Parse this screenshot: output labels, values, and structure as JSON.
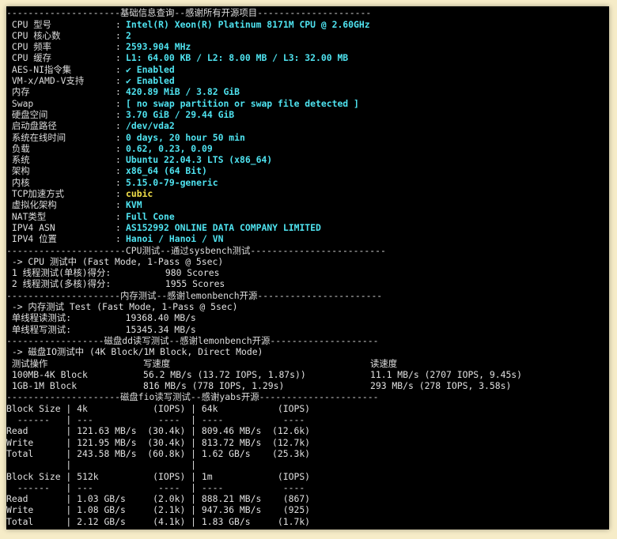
{
  "banners": {
    "basic": "---------------------基础信息查询--感谢所有开源项目---------------------",
    "cpu": "----------------------CPU测试--通过sysbench测试-------------------------",
    "mem": "---------------------内存测试--感谢lemonbench开源-----------------------",
    "disk_dd": "------------------磁盘dd读写测试--感谢lemonbench开源--------------------",
    "fio": "---------------------磁盘fio读写测试--感谢yabs开源----------------------"
  },
  "basic_info": [
    {
      "label": " CPU 型号",
      "value": "Intel(R) Xeon(R) Platinum 8171M CPU @ 2.60GHz",
      "color": "cyan"
    },
    {
      "label": " CPU 核心数",
      "value": "2",
      "color": "cyan"
    },
    {
      "label": " CPU 频率",
      "value": "2593.904 MHz",
      "color": "cyan"
    },
    {
      "label": " CPU 缓存",
      "value": "L1: 64.00 KB / L2: 8.00 MB / L3: 32.00 MB",
      "color": "cyan"
    },
    {
      "label": " AES-NI指令集",
      "value": "✔ Enabled",
      "color": "cyan"
    },
    {
      "label": " VM-x/AMD-V支持",
      "value": "✔ Enabled",
      "color": "cyan"
    },
    {
      "label": " 内存",
      "value": "420.89 MiB / 3.82 GiB",
      "color": "cyan"
    },
    {
      "label": " Swap",
      "value": "[ no swap partition or swap file detected ]",
      "color": "cyan"
    },
    {
      "label": " 硬盘空间",
      "value": "3.70 GiB / 29.44 GiB",
      "color": "cyan"
    },
    {
      "label": " 启动盘路径",
      "value": "/dev/vda2",
      "color": "cyan"
    },
    {
      "label": " 系统在线时间",
      "value": "0 days, 20 hour 50 min",
      "color": "cyan"
    },
    {
      "label": " 负载",
      "value": "0.62, 0.23, 0.09",
      "color": "cyan"
    },
    {
      "label": " 系统",
      "value": "Ubuntu 22.04.3 LTS (x86_64)",
      "color": "cyan"
    },
    {
      "label": " 架构",
      "value": "x86_64 (64 Bit)",
      "color": "cyan"
    },
    {
      "label": " 内核",
      "value": "5.15.0-79-generic",
      "color": "cyan"
    },
    {
      "label": " TCP加速方式",
      "value": "cubic",
      "color": "yellow"
    },
    {
      "label": " 虚拟化架构",
      "value": "KVM",
      "color": "cyan"
    },
    {
      "label": " NAT类型",
      "value": "Full Cone",
      "color": "cyan"
    },
    {
      "label": " IPV4 ASN",
      "value": "AS152992 ONLINE DATA COMPANY LIMITED",
      "color": "cyan"
    },
    {
      "label": " IPV4 位置",
      "value": "Hanoi / Hanoi / VN",
      "color": "cyan"
    }
  ],
  "cpu_test": {
    "header": " -> CPU 测试中 (Fast Mode, 1-Pass @ 5sec)",
    "single": " 1 线程测试(单核)得分:          980 Scores",
    "multi": " 2 线程测试(多核)得分:          1955 Scores"
  },
  "mem_test": {
    "header": " -> 内存测试 Test (Fast Mode, 1-Pass @ 5sec)",
    "read": " 单线程读测试:          19368.40 MB/s",
    "write": " 单线程写测试:          15345.34 MB/s"
  },
  "dd_test": {
    "header": " -> 磁盘IO测试中 (4K Block/1M Block, Direct Mode)",
    "columns": [
      " 测试操作",
      "写速度",
      "读速度"
    ],
    "rows": [
      [
        " 100MB-4K Block",
        "56.2 MB/s (13.72 IOPS, 1.87s))",
        "11.1 MB/s (2707 IOPS, 9.45s)"
      ],
      [
        " 1GB-1M Block",
        "816 MB/s (778 IOPS, 1.29s)",
        "293 MB/s (278 IOPS, 3.58s)"
      ]
    ]
  },
  "fio_lines": [
    "Block Size | 4k            (IOPS) | 64k           (IOPS)",
    "  ------   | ---            ----  | ----           ---- ",
    "Read       | 121.63 MB/s  (30.4k) | 809.46 MB/s  (12.6k)",
    "Write      | 121.95 MB/s  (30.4k) | 813.72 MB/s  (12.7k)",
    "Total      | 243.58 MB/s  (60.8k) | 1.62 GB/s    (25.3k)",
    "           |                      |                     ",
    "Block Size | 512k          (IOPS) | 1m            (IOPS)",
    "  ------   | ---            ----  | ----           ---- ",
    "Read       | 1.03 GB/s     (2.0k) | 888.21 MB/s    (867)",
    "Write      | 1.08 GB/s     (2.1k) | 947.36 MB/s    (925)",
    "Total      | 2.12 GB/s     (4.1k) | 1.83 GB/s     (1.7k)"
  ]
}
